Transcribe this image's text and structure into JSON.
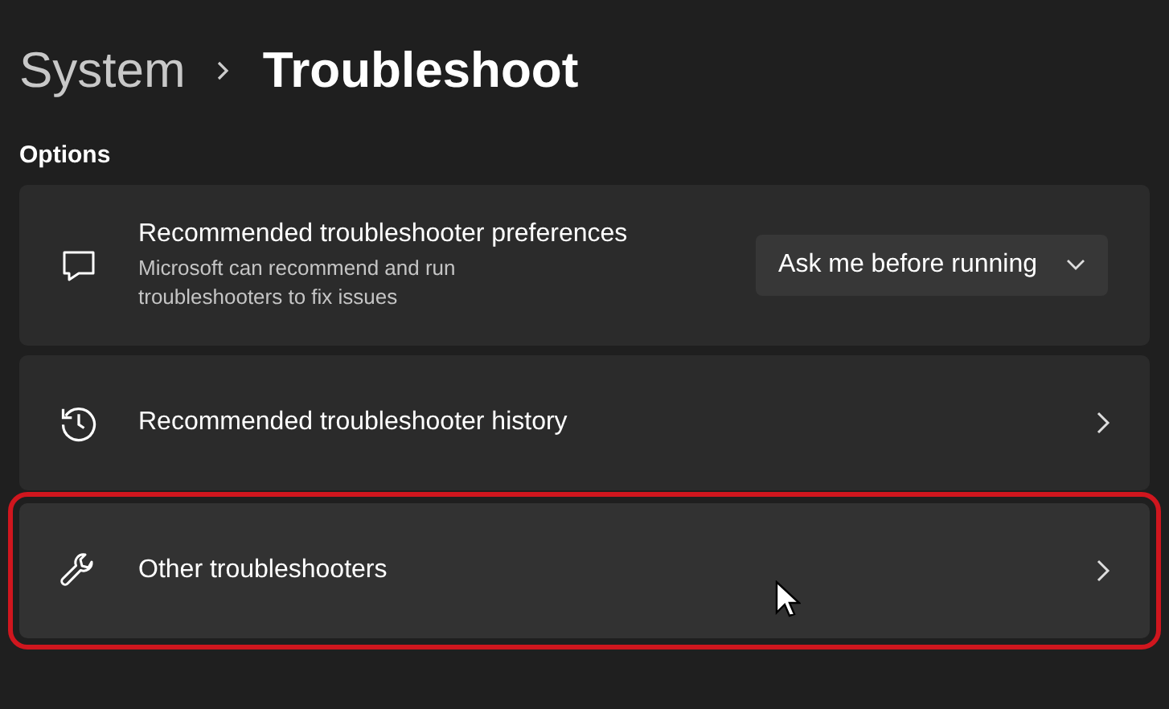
{
  "breadcrumb": [
    {
      "text": "System",
      "selected": false
    },
    {
      "text": "Troubleshoot",
      "selected": true
    }
  ],
  "section_title": "Options",
  "items": [
    {
      "kind": "dropdown",
      "title": "Recommended troubleshooter preferences",
      "description": "Microsoft can recommend and run troubleshooters to fix issues",
      "value": "Ask me before running",
      "highlighted": false
    },
    {
      "kind": "link",
      "title": "Recommended troubleshooter history",
      "highlighted": false
    },
    {
      "kind": "link",
      "title": "Other troubleshooters",
      "highlighted": true
    }
  ]
}
